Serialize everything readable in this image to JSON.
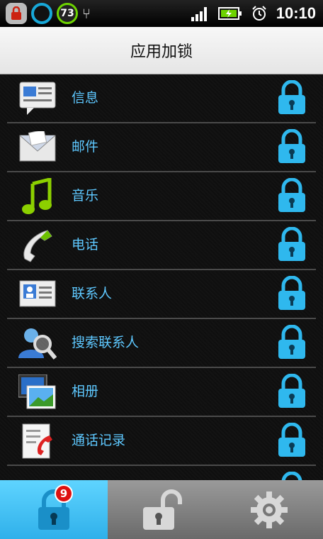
{
  "status_bar": {
    "battery_badge": "73",
    "time": "10:10"
  },
  "header": {
    "title": "应用加锁"
  },
  "apps": [
    {
      "label": "信息",
      "icon": "messages-icon"
    },
    {
      "label": "邮件",
      "icon": "mail-icon"
    },
    {
      "label": "音乐",
      "icon": "music-icon"
    },
    {
      "label": "电话",
      "icon": "phone-icon"
    },
    {
      "label": "联系人",
      "icon": "contacts-icon"
    },
    {
      "label": "搜索联系人",
      "icon": "search-contacts-icon"
    },
    {
      "label": "相册",
      "icon": "gallery-icon"
    },
    {
      "label": "通话记录",
      "icon": "call-log-icon"
    }
  ],
  "tabs": {
    "locked_badge": "9"
  },
  "colors": {
    "accent": "#2fb8ee",
    "label": "#5ec8ff"
  }
}
